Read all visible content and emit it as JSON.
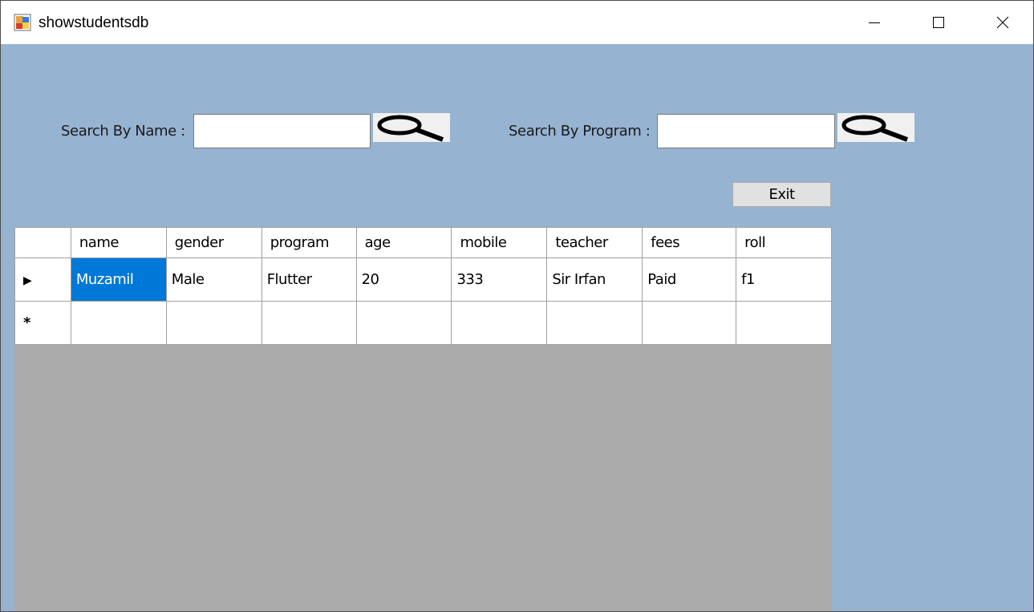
{
  "window": {
    "title": "showstudentsdb"
  },
  "search": {
    "name_label": "Search By Name :",
    "name_value": "",
    "program_label": "Search By Program :",
    "program_value": ""
  },
  "buttons": {
    "exit_label": "Exit"
  },
  "grid": {
    "columns": [
      "name",
      "gender",
      "program",
      "age",
      "mobile",
      "teacher",
      "fees",
      "roll"
    ],
    "rows": [
      [
        "Muzamil",
        "Male",
        "Flutter",
        "20",
        "333",
        "Sir Irfan",
        "Paid",
        "f1"
      ]
    ],
    "current_row_marker": "▶",
    "new_row_marker": "*"
  },
  "colors": {
    "form_background": "#97b3d2",
    "grid_background": "#ababab",
    "selection": "#0078d7"
  }
}
